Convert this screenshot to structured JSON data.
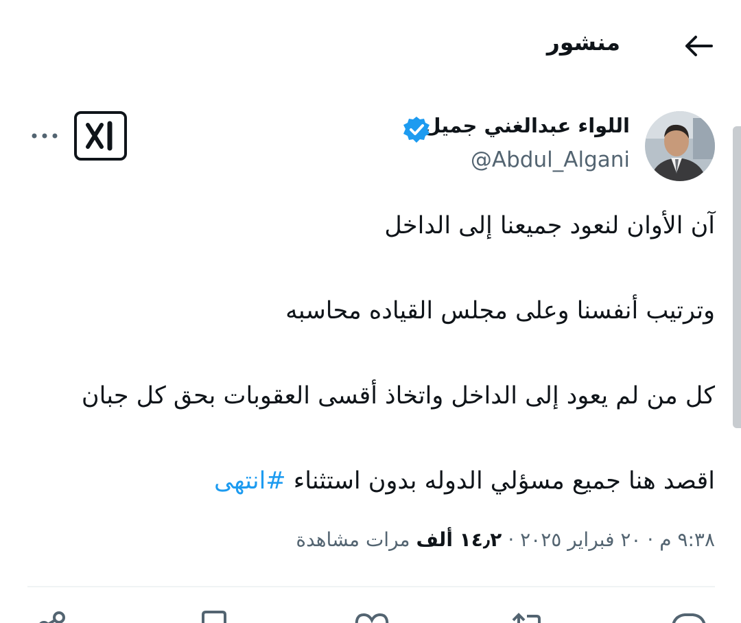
{
  "header": {
    "title": "منشور",
    "back_icon": "arrow-left-icon"
  },
  "author": {
    "name": "اللواء عبدالغني جميل",
    "handle": "@Abdul_Algani",
    "verified": true,
    "verified_color": "#1d9bf0"
  },
  "tweet": {
    "lines": [
      "آن الأوان لنعود جميعنا إلى الداخل",
      "وترتيب أنفسنا وعلى مجلس القياده محاسبه",
      "كل من لم يعود  إلى الداخل واتخاذ أقسى العقوبات بحق كل جبان"
    ],
    "last_line_text": "اقصد هنا جميع مسؤلي الدوله بدون استثناء ",
    "hashtag": "#انتهى"
  },
  "meta": {
    "time": "٩:٣٨ م",
    "date": "٢٠ فبراير ٢٠٢٥",
    "separator": "·",
    "views_count": "١٤٫٢ ألف",
    "views_label": "مرات مشاهدة"
  },
  "actions": [
    "share-icon",
    "bookmark-icon",
    "like-icon",
    "retweet-icon",
    "reply-icon"
  ],
  "colors": {
    "link": "#1d9bf0",
    "secondary_text": "#536471",
    "primary_text": "#0f1419",
    "divider": "#eff3f4"
  }
}
